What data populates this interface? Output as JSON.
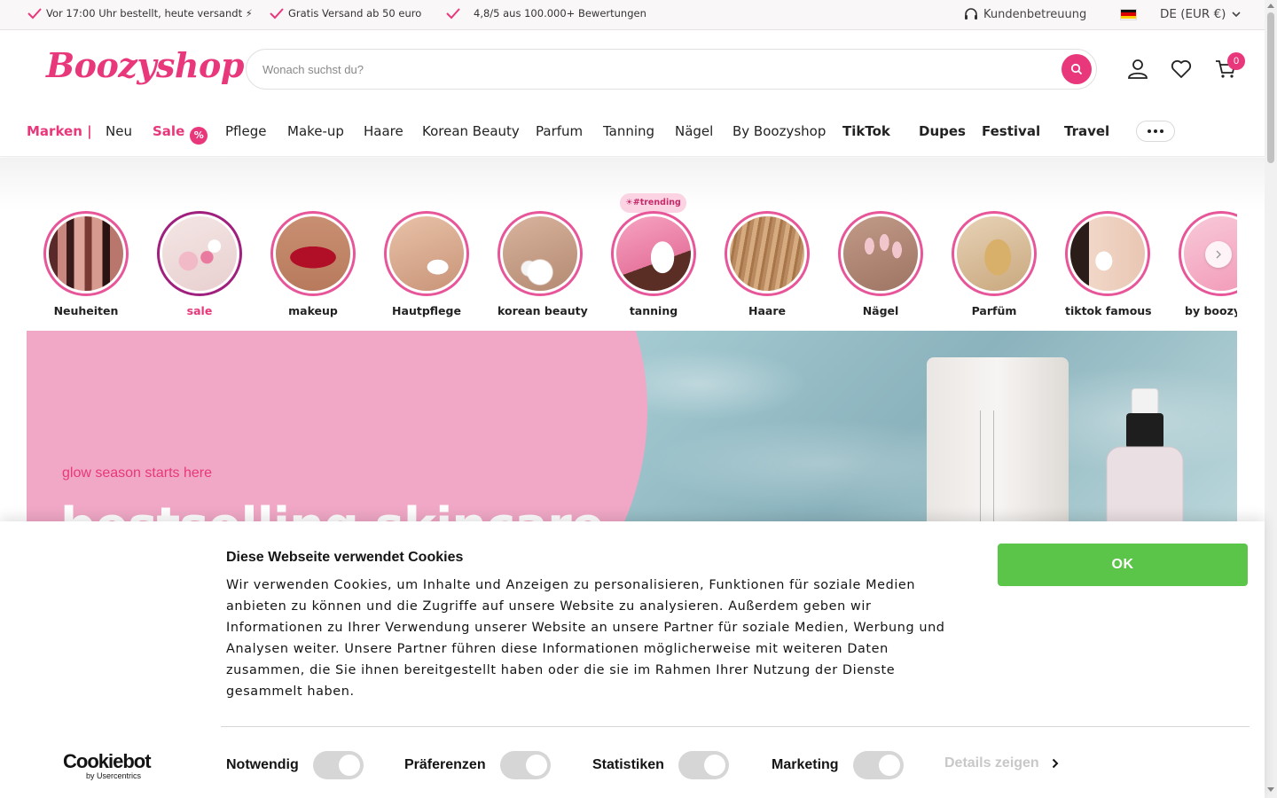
{
  "topbar": {
    "usp1": "Vor 17:00 Uhr bestellt, heute versandt ⚡",
    "usp2": "Gratis Versand ab 50 euro",
    "usp3": "4,8/5 aus 100.000+ Bewertungen",
    "help": "Kundenbetreuung",
    "lang": "DE (EUR €)"
  },
  "header": {
    "logo": "Boozyshop",
    "search_placeholder": "Wonach suchst du?",
    "cart_count": "0"
  },
  "nav": {
    "marken": "Marken |",
    "neu": "Neu",
    "sale": "Sale",
    "sale_badge": "%",
    "pflege": "Pflege",
    "makeup": "Make-up",
    "haare": "Haare",
    "korean": "Korean Beauty",
    "parfum": "Parfum",
    "tanning": "Tanning",
    "naegel": "Nägel",
    "byboozy": "By Boozyshop",
    "tiktok": "TikTok",
    "dupes": "Dupes",
    "festival": "Festival",
    "travel": "Travel"
  },
  "stories": {
    "trending_badge": "☀#trending",
    "items": [
      {
        "label": "Neuheiten"
      },
      {
        "label": "sale"
      },
      {
        "label": "makeup"
      },
      {
        "label": "Hautpflege"
      },
      {
        "label": "korean beauty"
      },
      {
        "label": "tanning"
      },
      {
        "label": "Haare"
      },
      {
        "label": "Nägel"
      },
      {
        "label": "Parfüm"
      },
      {
        "label": "tiktok famous"
      },
      {
        "label": "by boozys"
      }
    ]
  },
  "hero": {
    "tagline": "glow season starts here",
    "headline": "bestselling skincare"
  },
  "cookie": {
    "title": "Diese Webseite verwendet Cookies",
    "body": "Wir verwenden Cookies, um Inhalte und Anzeigen zu personalisieren, Funktionen für soziale Medien anbieten zu können und die Zugriffe auf unsere Website zu analysieren. Außerdem geben wir Informationen zu Ihrer Verwendung unserer Website an unsere Partner für soziale Medien, Werbung und Analysen weiter. Unsere Partner führen diese Informationen möglicherweise mit weiteren Daten zusammen, die Sie ihnen bereitgestellt haben oder die sie im Rahmen Ihrer Nutzung der Dienste gesammelt haben.",
    "ok": "OK",
    "brand_main": "Cookiebot",
    "brand_sub": "by Usercentrics",
    "toggles": {
      "necessary": "Notwendig",
      "preferences": "Präferenzen",
      "statistics": "Statistiken",
      "marketing": "Marketing"
    },
    "details": "Details zeigen"
  },
  "colors": {
    "brand_pink": "#e8387b",
    "ok_green": "#5ac548",
    "toggle_grey": "#d6d6d6"
  }
}
